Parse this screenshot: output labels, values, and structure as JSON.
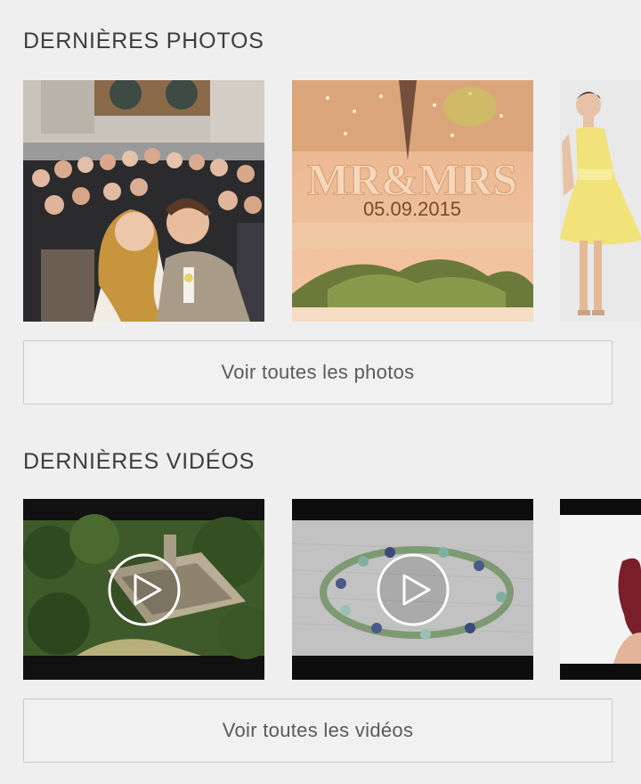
{
  "photos": {
    "title": "DERNIÈRES PHOTOS",
    "items": [
      {
        "subject": "wedding-kiss-crowd"
      },
      {
        "subject": "mr-mrs-table-decor",
        "sign_text": "MR&MRS",
        "date_text": "05.09.2015"
      },
      {
        "subject": "yellow-dress-model"
      }
    ],
    "button_label": "Voir toutes les photos"
  },
  "videos": {
    "title": "DERNIÈRES VIDÉOS",
    "items": [
      {
        "subject": "aerial-castle",
        "icon": "play-icon"
      },
      {
        "subject": "flower-wreath",
        "icon": "play-icon"
      },
      {
        "subject": "bride-portrait"
      }
    ],
    "button_label": "Voir toutes les vidéos"
  },
  "colors": {
    "background": "#efefef",
    "button_border": "#c9c9c9",
    "title_text": "#3d3d3d",
    "button_text": "#5a5a5a"
  }
}
